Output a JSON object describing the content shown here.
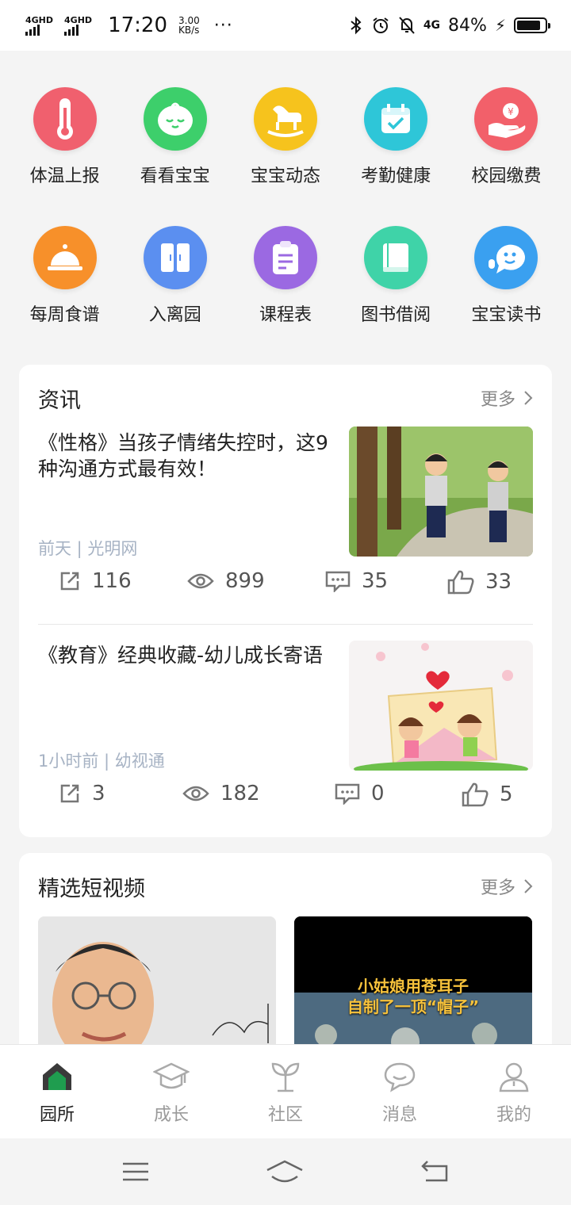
{
  "status_bar": {
    "network1": "4GHD",
    "network2": "4GHD",
    "time": "17:20",
    "speed_value": "3.00",
    "speed_unit": "KB/s",
    "more_dots": "···",
    "lte": "4G",
    "battery": "84%",
    "battery_level": 0.84
  },
  "grid": {
    "row1": [
      {
        "label": "体温上报",
        "icon": "thermometer-icon",
        "color": "#f0606e"
      },
      {
        "label": "看看宝宝",
        "icon": "baby-face-icon",
        "color": "#3dcf6b"
      },
      {
        "label": "宝宝动态",
        "icon": "rocking-horse-icon",
        "color": "#f6c31d"
      },
      {
        "label": "考勤健康",
        "icon": "calendar-check-icon",
        "color": "#2ec6d8"
      },
      {
        "label": "校园缴费",
        "icon": "hand-coin-icon",
        "color": "#f2606a"
      }
    ],
    "row2": [
      {
        "label": "每周食谱",
        "icon": "food-cloche-icon",
        "color": "#f7902a"
      },
      {
        "label": "入离园",
        "icon": "double-door-icon",
        "color": "#5b8ff0"
      },
      {
        "label": "课程表",
        "icon": "clipboard-icon",
        "color": "#9b69e2"
      },
      {
        "label": "图书借阅",
        "icon": "book-icon",
        "color": "#3fd3a8"
      },
      {
        "label": "宝宝读书",
        "icon": "speech-bubble-mic-icon",
        "color": "#3aa0f0"
      }
    ]
  },
  "news": {
    "title": "资讯",
    "more": "更多",
    "items": [
      {
        "title": "《性格》当孩子情绪失控时，这9种沟通方式最有效！",
        "meta": "前天 | 光明网",
        "share": "116",
        "views": "899",
        "comments": "35",
        "likes": "33"
      },
      {
        "title": "《教育》经典收藏-幼儿成长寄语",
        "meta": "1小时前 | 幼视通",
        "share": "3",
        "views": "182",
        "comments": "0",
        "likes": "5"
      }
    ]
  },
  "videos": {
    "title": "精选短视频",
    "more": "更多",
    "items": [
      {
        "caption_line1": "",
        "caption_line2": ""
      },
      {
        "caption_line1": "小姑娘用苍耳子",
        "caption_line2": "自制了一顶“帽子”"
      }
    ]
  },
  "tabbar": {
    "tabs": [
      {
        "label": "园所",
        "icon": "house-icon",
        "active": true
      },
      {
        "label": "成长",
        "icon": "graduation-cap-icon",
        "active": false
      },
      {
        "label": "社区",
        "icon": "sprout-icon",
        "active": false
      },
      {
        "label": "消息",
        "icon": "chat-bubble-icon",
        "active": false
      },
      {
        "label": "我的",
        "icon": "person-icon",
        "active": false
      }
    ]
  },
  "colors": {
    "accent_green": "#1f9d4f",
    "meta_text": "#a7b3c4",
    "background": "#f4f4f4"
  }
}
